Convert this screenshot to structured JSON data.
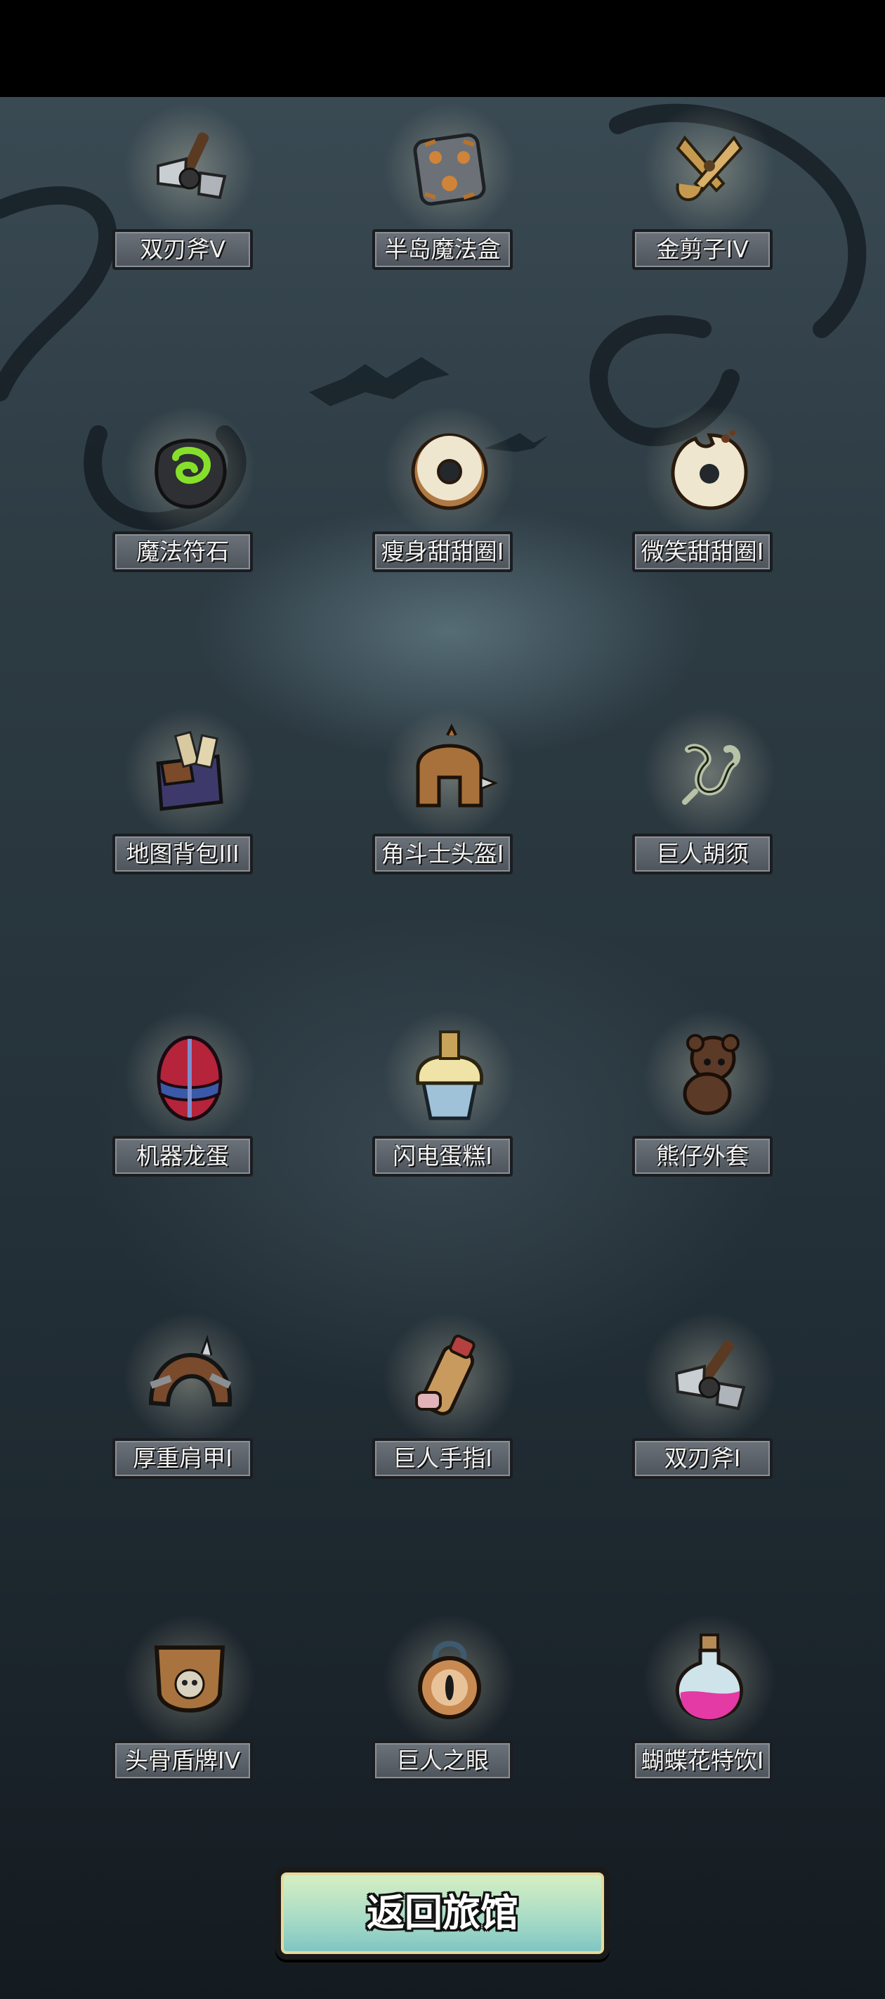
{
  "items": [
    {
      "label": "双刃斧V",
      "icon": "double-blade-axe-icon"
    },
    {
      "label": "半岛魔法盒",
      "icon": "magic-box-icon"
    },
    {
      "label": "金剪子IV",
      "icon": "golden-scissors-icon"
    },
    {
      "label": "魔法符石",
      "icon": "rune-stone-icon"
    },
    {
      "label": "瘦身甜甜圈I",
      "icon": "donut-icon"
    },
    {
      "label": "微笑甜甜圈I",
      "icon": "bitten-donut-icon"
    },
    {
      "label": "地图背包III",
      "icon": "map-backpack-icon"
    },
    {
      "label": "角斗士头盔I",
      "icon": "gladiator-helmet-icon"
    },
    {
      "label": "巨人胡须",
      "icon": "giant-beard-icon"
    },
    {
      "label": "机器龙蛋",
      "icon": "robot-dragon-egg-icon"
    },
    {
      "label": "闪电蛋糕I",
      "icon": "cupcake-icon"
    },
    {
      "label": "熊仔外套",
      "icon": "teddy-bear-icon"
    },
    {
      "label": "厚重肩甲I",
      "icon": "shoulder-armor-icon"
    },
    {
      "label": "巨人手指I",
      "icon": "giant-finger-icon"
    },
    {
      "label": "双刃斧I",
      "icon": "double-blade-axe-icon"
    },
    {
      "label": "头骨盾牌IV",
      "icon": "skull-shield-icon"
    },
    {
      "label": "巨人之眼",
      "icon": "giant-eye-amulet-icon"
    },
    {
      "label": "蝴蝶花特饮I",
      "icon": "potion-bottle-icon"
    }
  ],
  "return_button": {
    "label": "返回旅馆"
  }
}
